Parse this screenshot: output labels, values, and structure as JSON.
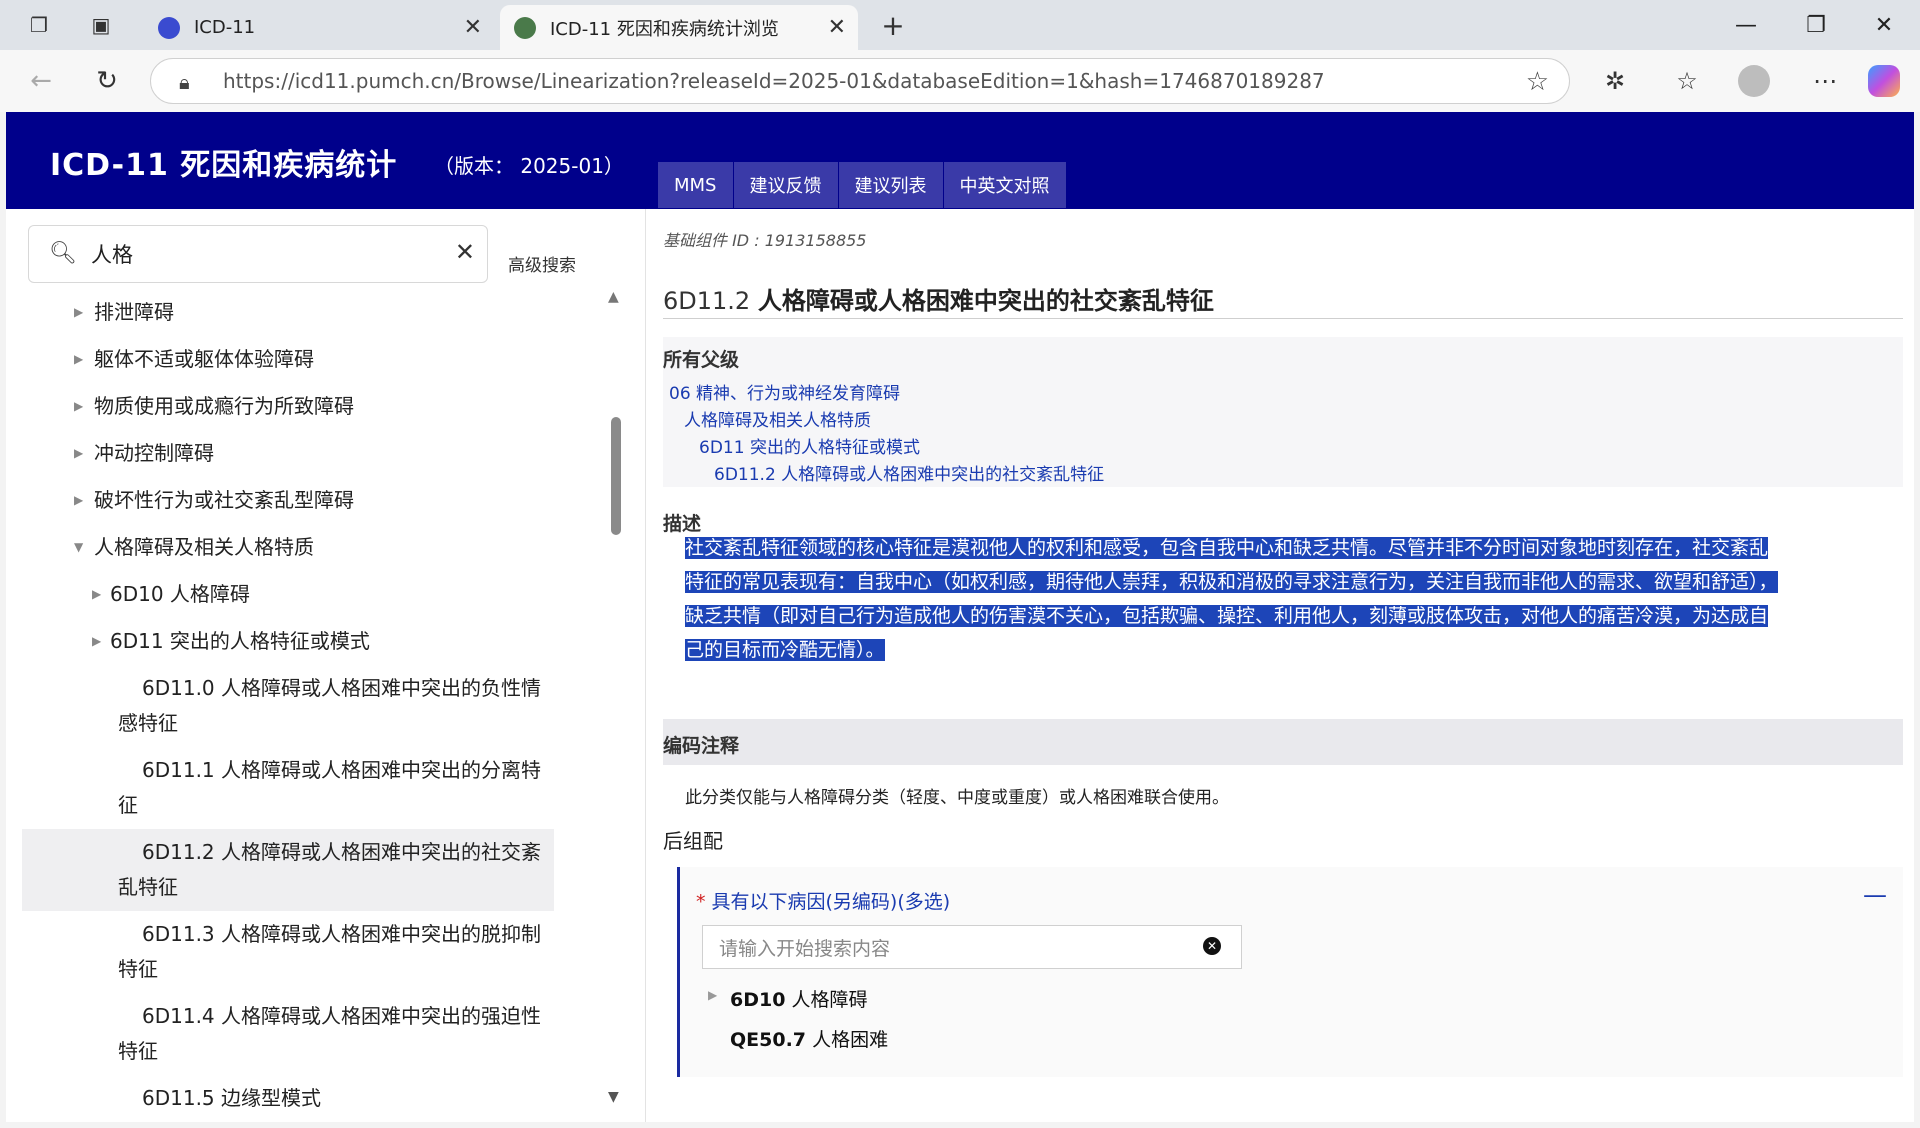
{
  "browser": {
    "tabs": [
      {
        "title": "ICD-11",
        "active": false
      },
      {
        "title": "ICD-11 死因和疾病统计浏览",
        "active": true
      }
    ],
    "new_tab_symbol": "+",
    "url": "https://icd11.pumch.cn/Browse/Linearization?releaseId=2025-01&databaseEdition=1&hash=1746870189287"
  },
  "site": {
    "title": "ICD-11 死因和疾病统计",
    "version": "（版本： 2025-01）",
    "nav": [
      "MMS",
      "建议反馈",
      "建议列表",
      "中英文对照"
    ]
  },
  "search": {
    "value": "人格",
    "advanced_label": "高级搜索"
  },
  "tree": [
    {
      "label": "排泄障碍",
      "level": 0,
      "arrow": "right",
      "selected": false
    },
    {
      "label": "躯体不适或躯体体验障碍",
      "level": 0,
      "arrow": "right",
      "selected": false
    },
    {
      "label": "物质使用或成瘾行为所致障碍",
      "level": 0,
      "arrow": "right",
      "selected": false
    },
    {
      "label": "冲动控制障碍",
      "level": 0,
      "arrow": "right",
      "selected": false
    },
    {
      "label": "破坏性行为或社交紊乱型障碍",
      "level": 0,
      "arrow": "right",
      "selected": false
    },
    {
      "label": "人格障碍及相关人格特质",
      "level": 0,
      "arrow": "down",
      "selected": false
    },
    {
      "label": "6D10 人格障碍",
      "level": 1,
      "arrow": "right",
      "selected": false
    },
    {
      "label": "6D11 突出的人格特征或模式",
      "level": 1,
      "arrow": "right",
      "selected": false
    },
    {
      "label": "6D11.0 人格障碍或人格困难中突出的负性情感特征",
      "level": 2,
      "arrow": "",
      "selected": false
    },
    {
      "label": "6D11.1 人格障碍或人格困难中突出的分离特征",
      "level": 2,
      "arrow": "",
      "selected": false
    },
    {
      "label": "6D11.2 人格障碍或人格困难中突出的社交紊乱特征",
      "level": 2,
      "arrow": "",
      "selected": true
    },
    {
      "label": "6D11.3 人格障碍或人格困难中突出的脱抑制特征",
      "level": 2,
      "arrow": "",
      "selected": false
    },
    {
      "label": "6D11.4 人格障碍或人格困难中突出的强迫性特征",
      "level": 2,
      "arrow": "",
      "selected": false
    },
    {
      "label": "6D11.5 边缘型模式",
      "level": 2,
      "arrow": "",
      "selected": false
    }
  ],
  "entity": {
    "base_id": "基础组件 ID : 1913158855",
    "code": "6D11.2",
    "name": "人格障碍或人格困难中突出的社交紊乱特征",
    "parents_heading": "所有父级",
    "parents": [
      "06 精神、行为或神经发育障碍",
      "人格障碍及相关人格特质",
      "6D11 突出的人格特征或模式",
      "6D11.2 人格障碍或人格困难中突出的社交紊乱特征"
    ],
    "description_heading": "描述",
    "description_lines": [
      "社交紊乱特征领域的核心特征是漠视他人的权利和感受，包含自我中心和缺乏共情。尽管并非不分时间对象地时刻存在，社交紊乱",
      "特征的常见表现有：自我中心（如权利感，期待他人崇拜，积极和消极的寻求注意行为，关注自我而非他人的需求、欲望和舒适），",
      "缺乏共情（即对自己行为造成他人的伤害漠不关心，包括欺骗、操控、利用他人，刻薄或肢体攻击，对他人的痛苦冷漠，为达成自",
      "己的目标而冷酷无情）。"
    ],
    "coding_note_heading": "编码注释",
    "coding_note": "此分类仅能与人格障碍分类（轻度、中度或重度）或人格困难联合使用。",
    "postcoord_heading": "后组配",
    "postcoord": {
      "required_mark": "*",
      "label": "具有以下病因(另编码)(多选)",
      "collapse_symbol": "—",
      "input_placeholder": "请输入开始搜索内容",
      "options": [
        {
          "code": "6D10",
          "name": "人格障碍"
        },
        {
          "code": "QE50.7",
          "name": "人格困难"
        }
      ]
    }
  }
}
